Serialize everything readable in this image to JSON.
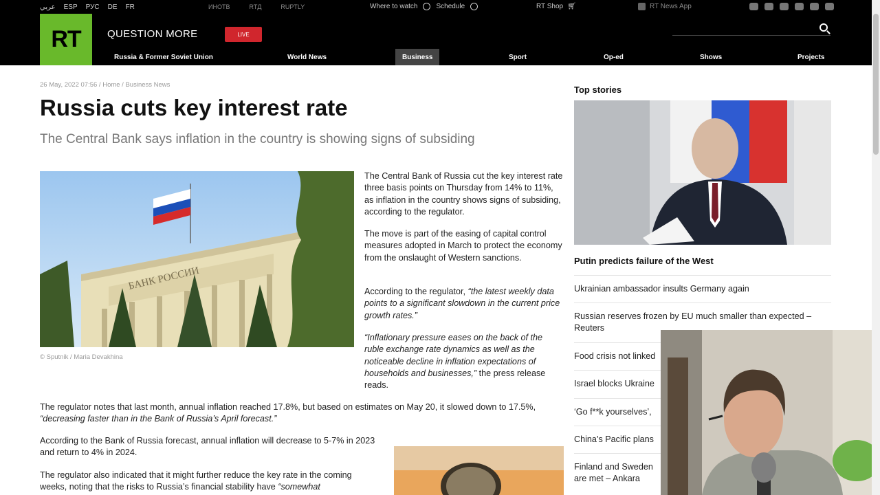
{
  "topstrip": {
    "languages": [
      "عربي",
      "ESP",
      "РУС",
      "DE",
      "FR"
    ],
    "brands": [
      "ИНОТВ",
      "RTД",
      "RUPTLY"
    ],
    "where_to_watch": "Where to watch",
    "schedule": "Schedule",
    "shop": "RT Shop",
    "news_app": "RT News App"
  },
  "header": {
    "logo": "RT",
    "slogan": "QUESTION MORE",
    "live": "LIVE",
    "nav": [
      "Russia & Former Soviet Union",
      "World News",
      "Business",
      "Sport",
      "Op-ed",
      "Shows",
      "Projects"
    ],
    "active_nav": "Business"
  },
  "article": {
    "date": "26 May, 2022 07:56",
    "breadcrumb_home": "Home",
    "breadcrumb_section": "Business News",
    "title": "Russia cuts key interest rate",
    "subtitle": "The Central Bank says inflation in the country is showing signs of subsiding",
    "image_credit": "© Sputnik / Maria Devakhina",
    "building_sign": "БАНК РОССИИ",
    "p1": "The Central Bank of Russia cut the key interest rate three basis points on Thursday from 14% to 11%, as inflation in the country shows signs of subsiding, according to the regulator.",
    "p2": "The move is part of the easing of capital control measures adopted in March to protect the economy from the onslaught of Western sanctions.",
    "p3_lead": "According to the regulator, ",
    "p3_quote": "“the latest weekly data points to a significant slowdown in the current price growth rates.”",
    "p4_quote": "“Inflationary pressure eases on the back of the ruble exchange rate dynamics as well as the noticeable decline in inflation expectations of households and businesses,”",
    "p4_tail": " the press release reads.",
    "p5_lead": "The regulator notes that last month, annual inflation reached 17.8%, but based on estimates on May 20, it slowed down to 17.5%, ",
    "p5_quote": "“decreasing faster than in the Bank of Russia’s April forecast.”",
    "p6": "According to the Bank of Russia forecast, annual inflation will decrease to 5-7% in 2023 and return to 4% in 2024.",
    "p7_lead": "The regulator also indicated that it might further reduce the key rate in the coming weeks, noting that the risks to Russia’s financial stability have ",
    "p7_quote": "“somewhat"
  },
  "sidebar": {
    "title": "Top stories",
    "lead": "Putin predicts failure of the West",
    "stories": [
      "Ukrainian ambassador insults Germany again",
      "Russian reserves frozen by EU much smaller than expected – Reuters",
      "Food crisis not linked",
      "Israel blocks Ukraine",
      "‘Go f**k yourselves’,",
      "China’s Pacific plans",
      "Finland and Sweden are met – Ankara"
    ],
    "story_6_line1": "Finland and Sweden",
    "story_6_line2": "are met – Ankara"
  },
  "colors": {
    "brand_green": "#69b92b",
    "live_red": "#d0262d",
    "header_bg": "#000000"
  }
}
